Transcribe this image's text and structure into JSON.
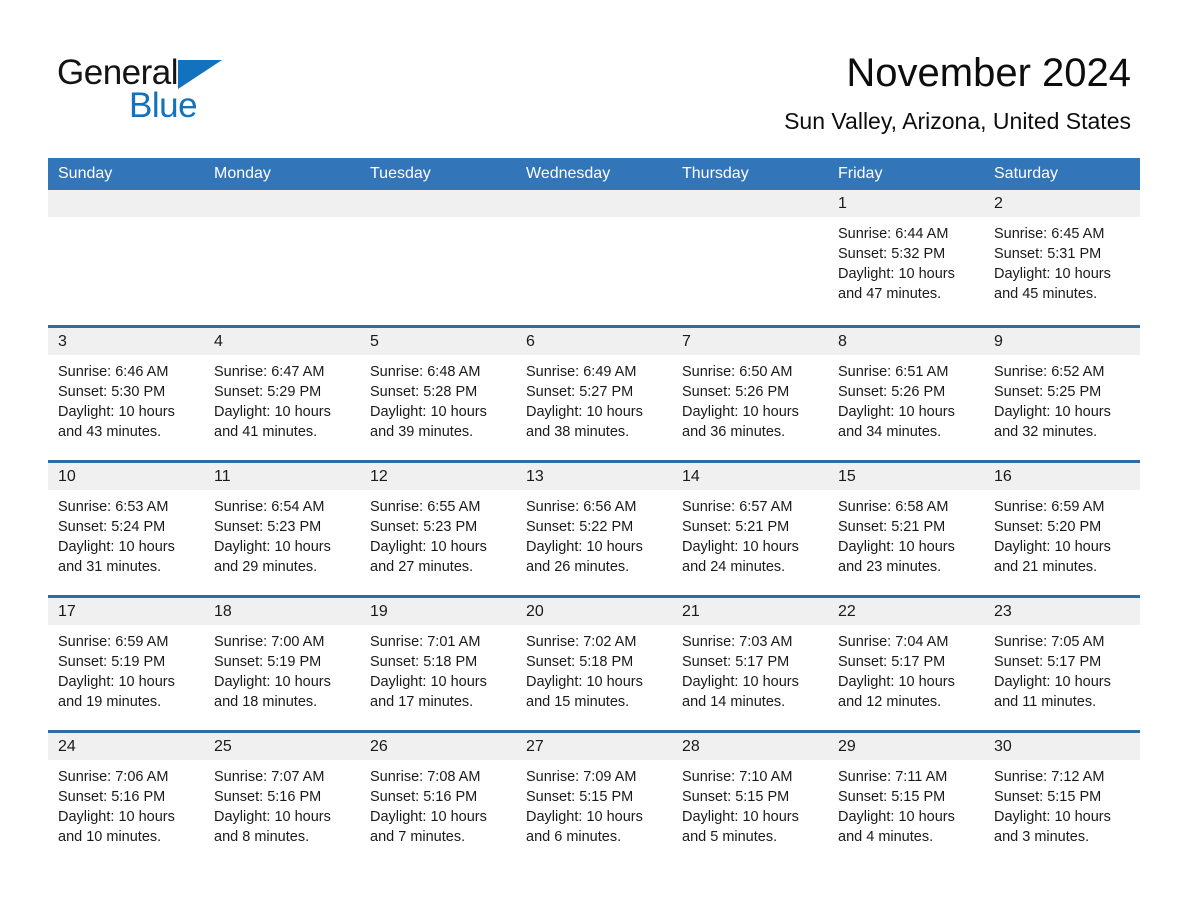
{
  "brand": {
    "name_part1": "General",
    "name_part2": "Blue",
    "logo_icon": "blue-triangle-logo",
    "accent_color": "#1272bd"
  },
  "header": {
    "title": "November 2024",
    "subtitle": "Sun Valley, Arizona, United States"
  },
  "theme": {
    "header_row_bg": "#3275b8",
    "row_divider": "#2e6da4",
    "daynum_band_bg": "#f0f0f0",
    "cell_bg": "#ffffff",
    "text_color": "#1a1a1a"
  },
  "weekday_headers": [
    "Sunday",
    "Monday",
    "Tuesday",
    "Wednesday",
    "Thursday",
    "Friday",
    "Saturday"
  ],
  "weeks": [
    [
      {
        "empty": true
      },
      {
        "empty": true
      },
      {
        "empty": true
      },
      {
        "empty": true
      },
      {
        "empty": true
      },
      {
        "day": "1",
        "sunrise": "Sunrise: 6:44 AM",
        "sunset": "Sunset: 5:32 PM",
        "daylight": "Daylight: 10 hours and 47 minutes."
      },
      {
        "day": "2",
        "sunrise": "Sunrise: 6:45 AM",
        "sunset": "Sunset: 5:31 PM",
        "daylight": "Daylight: 10 hours and 45 minutes."
      }
    ],
    [
      {
        "day": "3",
        "sunrise": "Sunrise: 6:46 AM",
        "sunset": "Sunset: 5:30 PM",
        "daylight": "Daylight: 10 hours and 43 minutes."
      },
      {
        "day": "4",
        "sunrise": "Sunrise: 6:47 AM",
        "sunset": "Sunset: 5:29 PM",
        "daylight": "Daylight: 10 hours and 41 minutes."
      },
      {
        "day": "5",
        "sunrise": "Sunrise: 6:48 AM",
        "sunset": "Sunset: 5:28 PM",
        "daylight": "Daylight: 10 hours and 39 minutes."
      },
      {
        "day": "6",
        "sunrise": "Sunrise: 6:49 AM",
        "sunset": "Sunset: 5:27 PM",
        "daylight": "Daylight: 10 hours and 38 minutes."
      },
      {
        "day": "7",
        "sunrise": "Sunrise: 6:50 AM",
        "sunset": "Sunset: 5:26 PM",
        "daylight": "Daylight: 10 hours and 36 minutes."
      },
      {
        "day": "8",
        "sunrise": "Sunrise: 6:51 AM",
        "sunset": "Sunset: 5:26 PM",
        "daylight": "Daylight: 10 hours and 34 minutes."
      },
      {
        "day": "9",
        "sunrise": "Sunrise: 6:52 AM",
        "sunset": "Sunset: 5:25 PM",
        "daylight": "Daylight: 10 hours and 32 minutes."
      }
    ],
    [
      {
        "day": "10",
        "sunrise": "Sunrise: 6:53 AM",
        "sunset": "Sunset: 5:24 PM",
        "daylight": "Daylight: 10 hours and 31 minutes."
      },
      {
        "day": "11",
        "sunrise": "Sunrise: 6:54 AM",
        "sunset": "Sunset: 5:23 PM",
        "daylight": "Daylight: 10 hours and 29 minutes."
      },
      {
        "day": "12",
        "sunrise": "Sunrise: 6:55 AM",
        "sunset": "Sunset: 5:23 PM",
        "daylight": "Daylight: 10 hours and 27 minutes."
      },
      {
        "day": "13",
        "sunrise": "Sunrise: 6:56 AM",
        "sunset": "Sunset: 5:22 PM",
        "daylight": "Daylight: 10 hours and 26 minutes."
      },
      {
        "day": "14",
        "sunrise": "Sunrise: 6:57 AM",
        "sunset": "Sunset: 5:21 PM",
        "daylight": "Daylight: 10 hours and 24 minutes."
      },
      {
        "day": "15",
        "sunrise": "Sunrise: 6:58 AM",
        "sunset": "Sunset: 5:21 PM",
        "daylight": "Daylight: 10 hours and 23 minutes."
      },
      {
        "day": "16",
        "sunrise": "Sunrise: 6:59 AM",
        "sunset": "Sunset: 5:20 PM",
        "daylight": "Daylight: 10 hours and 21 minutes."
      }
    ],
    [
      {
        "day": "17",
        "sunrise": "Sunrise: 6:59 AM",
        "sunset": "Sunset: 5:19 PM",
        "daylight": "Daylight: 10 hours and 19 minutes."
      },
      {
        "day": "18",
        "sunrise": "Sunrise: 7:00 AM",
        "sunset": "Sunset: 5:19 PM",
        "daylight": "Daylight: 10 hours and 18 minutes."
      },
      {
        "day": "19",
        "sunrise": "Sunrise: 7:01 AM",
        "sunset": "Sunset: 5:18 PM",
        "daylight": "Daylight: 10 hours and 17 minutes."
      },
      {
        "day": "20",
        "sunrise": "Sunrise: 7:02 AM",
        "sunset": "Sunset: 5:18 PM",
        "daylight": "Daylight: 10 hours and 15 minutes."
      },
      {
        "day": "21",
        "sunrise": "Sunrise: 7:03 AM",
        "sunset": "Sunset: 5:17 PM",
        "daylight": "Daylight: 10 hours and 14 minutes."
      },
      {
        "day": "22",
        "sunrise": "Sunrise: 7:04 AM",
        "sunset": "Sunset: 5:17 PM",
        "daylight": "Daylight: 10 hours and 12 minutes."
      },
      {
        "day": "23",
        "sunrise": "Sunrise: 7:05 AM",
        "sunset": "Sunset: 5:17 PM",
        "daylight": "Daylight: 10 hours and 11 minutes."
      }
    ],
    [
      {
        "day": "24",
        "sunrise": "Sunrise: 7:06 AM",
        "sunset": "Sunset: 5:16 PM",
        "daylight": "Daylight: 10 hours and 10 minutes."
      },
      {
        "day": "25",
        "sunrise": "Sunrise: 7:07 AM",
        "sunset": "Sunset: 5:16 PM",
        "daylight": "Daylight: 10 hours and 8 minutes."
      },
      {
        "day": "26",
        "sunrise": "Sunrise: 7:08 AM",
        "sunset": "Sunset: 5:16 PM",
        "daylight": "Daylight: 10 hours and 7 minutes."
      },
      {
        "day": "27",
        "sunrise": "Sunrise: 7:09 AM",
        "sunset": "Sunset: 5:15 PM",
        "daylight": "Daylight: 10 hours and 6 minutes."
      },
      {
        "day": "28",
        "sunrise": "Sunrise: 7:10 AM",
        "sunset": "Sunset: 5:15 PM",
        "daylight": "Daylight: 10 hours and 5 minutes."
      },
      {
        "day": "29",
        "sunrise": "Sunrise: 7:11 AM",
        "sunset": "Sunset: 5:15 PM",
        "daylight": "Daylight: 10 hours and 4 minutes."
      },
      {
        "day": "30",
        "sunrise": "Sunrise: 7:12 AM",
        "sunset": "Sunset: 5:15 PM",
        "daylight": "Daylight: 10 hours and 3 minutes."
      }
    ]
  ]
}
